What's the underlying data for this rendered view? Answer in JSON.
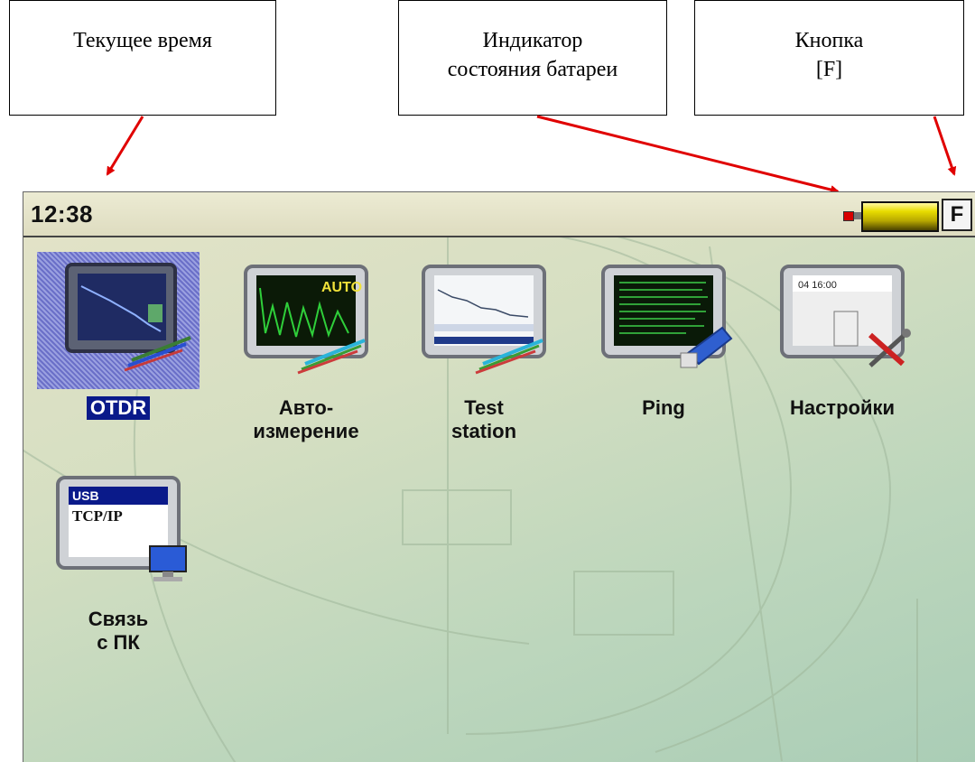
{
  "callouts": {
    "time": {
      "line1": "Текущее время"
    },
    "battery": {
      "line1": "Индикатор",
      "line2": "состояния батареи"
    },
    "f_button": {
      "line1": "Кнопка",
      "line2": "[F]"
    }
  },
  "statusbar": {
    "time": "12:38",
    "f_button_label": "F"
  },
  "apps": [
    {
      "label": "OTDR",
      "selected": true
    },
    {
      "label": "Авто-\nизмерение",
      "screen_text": "AUTO"
    },
    {
      "label": "Test\nstation"
    },
    {
      "label": "Ping"
    },
    {
      "label": "Настройки",
      "screen_text": "04 16:00"
    },
    {
      "label": "Связь\nс ПК",
      "screen_line1": "USB",
      "screen_line2": "TCP/IP"
    }
  ],
  "colors": {
    "arrow": "#e00000",
    "selection": "#0a1a8a"
  }
}
